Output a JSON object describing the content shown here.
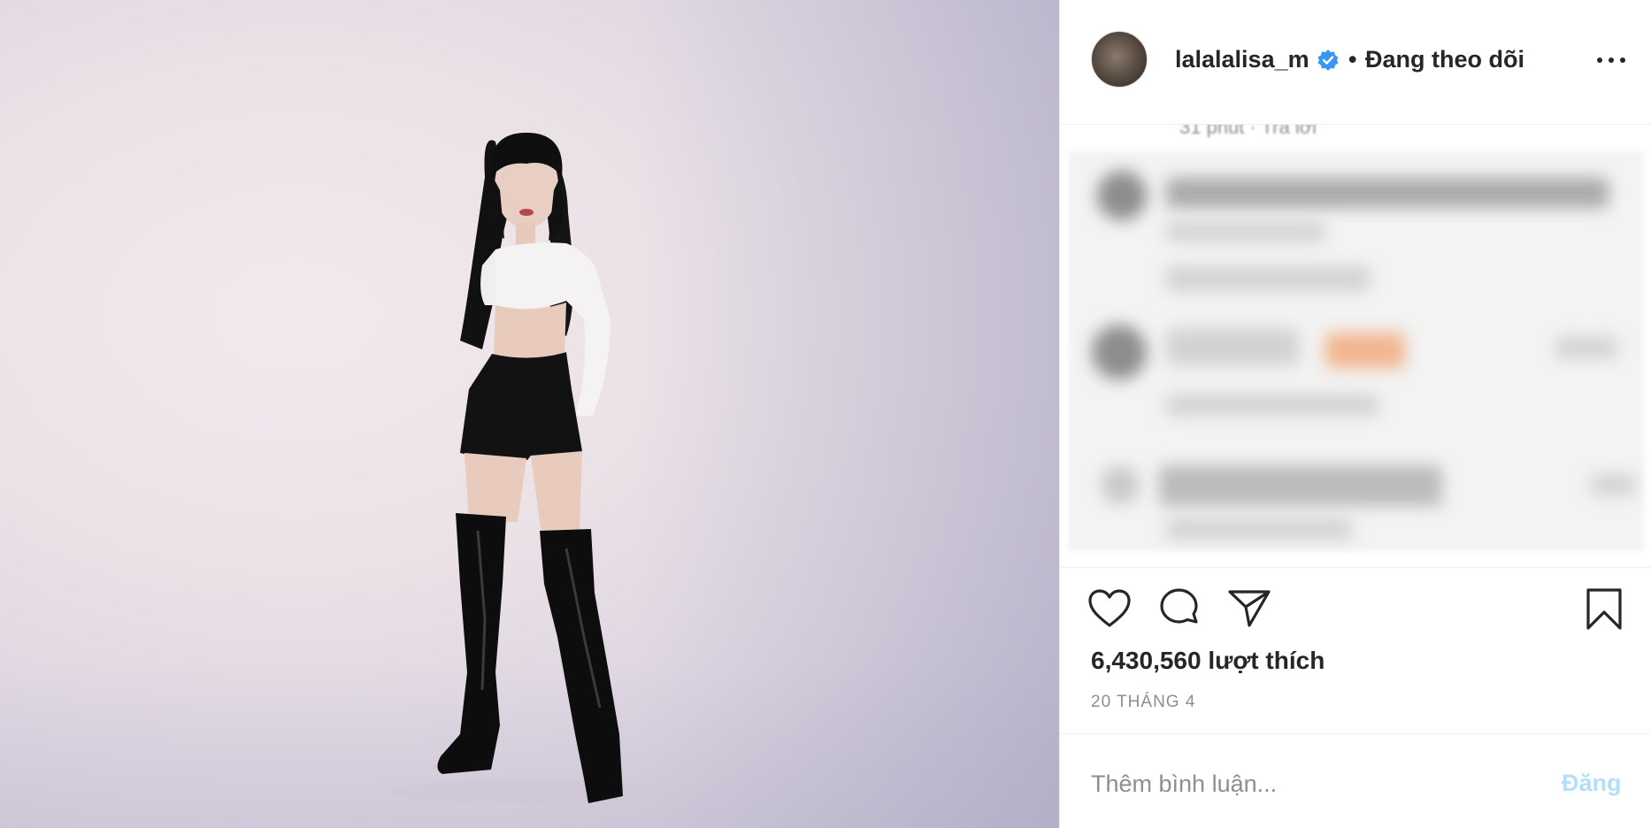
{
  "post": {
    "username": "lalalalisa_m",
    "separator": "•",
    "follow_status": "Đang theo dõi",
    "likes_text": "6,430,560 lượt thích",
    "date": "20 THÁNG 4"
  },
  "comments": {
    "meta": "31 phút  ·  Trả lời"
  },
  "comment_box": {
    "placeholder": "Thêm bình luận...",
    "post_label": "Đăng"
  },
  "icons": {
    "verified": "verified-badge-icon",
    "more": "more-options-icon",
    "like": "heart-icon",
    "comment": "comment-bubble-icon",
    "share": "paper-plane-icon",
    "save": "bookmark-icon"
  },
  "colors": {
    "verified_blue": "#3897f0",
    "post_button_disabled": "#b2dffc",
    "text_primary": "#262626",
    "text_secondary": "#8e8e8e"
  }
}
